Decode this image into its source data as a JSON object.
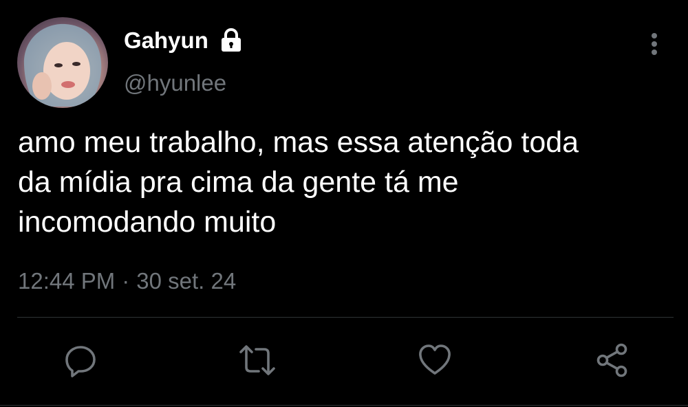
{
  "user": {
    "display_name": "Gahyun",
    "handle": "@hyunlee",
    "protected_icon": "lock-icon"
  },
  "tweet": {
    "text": "amo meu trabalho, mas essa atenção toda\nda mídia pra cima da gente tá me\nincomodando muito",
    "time": "12:44 PM",
    "separator": "·",
    "date": "30 set. 24"
  },
  "actions": [
    {
      "icon": "reply-icon"
    },
    {
      "icon": "retweet-icon"
    },
    {
      "icon": "like-icon"
    },
    {
      "icon": "share-icon"
    }
  ],
  "colors": {
    "background": "#000000",
    "text_primary": "#ffffff",
    "text_secondary": "#71767b",
    "divider": "#2f3336"
  }
}
